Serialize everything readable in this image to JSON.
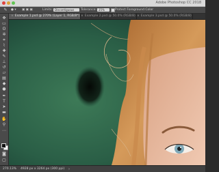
{
  "window": {
    "title": "Adobe Photoshop CC 2018"
  },
  "options_bar": {
    "limits_label": "Limits:",
    "limits_value": "Discontiguous",
    "tolerance_label": "Tolerance:",
    "tolerance_value": "25%",
    "protect_label": "Protect Foreground Color"
  },
  "tabs": [
    {
      "label": "Example 1.psd @ 270% (Layer 1, RGB/8*)",
      "active": true
    },
    {
      "label": "Example 2.psd @ 50.0% (RGB/8)",
      "active": false
    },
    {
      "label": "Example 3.psd @ 50.0% (RGB/8)",
      "active": false
    }
  ],
  "toolbar": {
    "tools": [
      "move-icon",
      "marquee-icon",
      "lasso-icon",
      "magic-wand-icon",
      "crop-icon",
      "eyedropper-icon",
      "healing-brush-icon",
      "brush-icon",
      "clone-stamp-icon",
      "history-brush-icon",
      "eraser-icon",
      "gradient-icon",
      "blur-icon",
      "dodge-icon",
      "pen-icon",
      "type-icon",
      "path-selection-icon",
      "shape-icon",
      "hand-icon",
      "zoom-icon",
      "more-tools-icon"
    ],
    "foreground_color": "#111111",
    "background_color": "#ffffff"
  },
  "status": {
    "zoom": "270.13%",
    "doc_info": "4928 px x 3264 px (300 ppi)"
  },
  "colors": {
    "canvas_green": "#2f6a4d",
    "hair": "#c98a4c",
    "skin": "#e7bca3",
    "eye": "#7fa9b8"
  }
}
